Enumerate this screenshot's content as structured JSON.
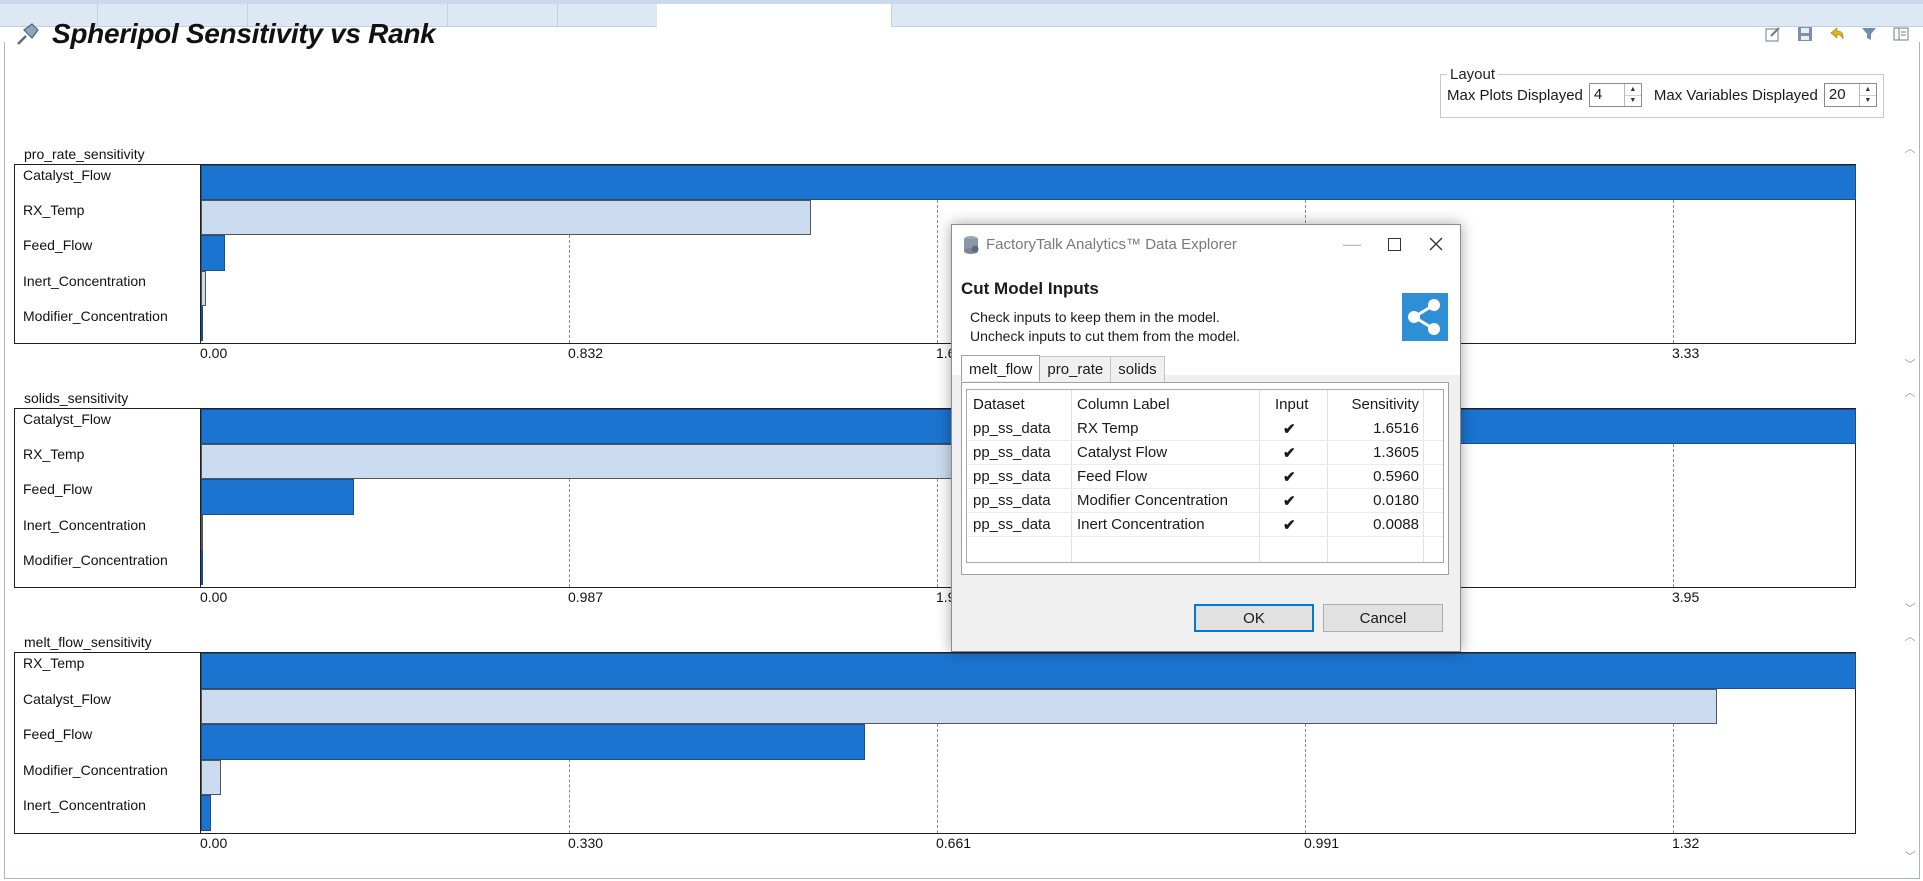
{
  "page": {
    "title": "Spheripol Sensitivity vs Rank"
  },
  "layout_box": {
    "legend": "Layout",
    "max_plots_label": "Max Plots Displayed",
    "max_plots_value": "4",
    "max_vars_label": "Max Variables Displayed",
    "max_vars_value": "20"
  },
  "charts": [
    {
      "name": "pro_rate_sensitivity",
      "rows": [
        {
          "label": "Catalyst_Flow",
          "value": 4.5,
          "style": "dark"
        },
        {
          "label": "RX_Temp",
          "value": 1.38,
          "style": "light"
        },
        {
          "label": "Feed_Flow",
          "value": 0.055,
          "style": "dark"
        },
        {
          "label": "Inert_Concentration",
          "value": 0.012,
          "style": "light"
        },
        {
          "label": "Modifier_Concentration",
          "value": 0.004,
          "style": "dark"
        }
      ],
      "ticks": [
        "0.00",
        "0.832",
        "1.6",
        "",
        "3.33"
      ],
      "tick_step": 0.832
    },
    {
      "name": "solids_sensitivity",
      "rows": [
        {
          "label": "Catalyst_Flow",
          "value": 4.5,
          "style": "dark"
        },
        {
          "label": "RX_Temp",
          "value": 2.1,
          "style": "light"
        },
        {
          "label": "Feed_Flow",
          "value": 0.41,
          "style": "dark"
        },
        {
          "label": "Inert_Concentration",
          "value": 0.006,
          "style": "light"
        },
        {
          "label": "Modifier_Concentration",
          "value": 0.003,
          "style": "dark"
        }
      ],
      "ticks": [
        "0.00",
        "0.987",
        "1.9",
        "",
        "3.95"
      ],
      "tick_step": 0.987
    },
    {
      "name": "melt_flow_sensitivity",
      "rows": [
        {
          "label": "RX_Temp",
          "value": 1.6516,
          "style": "dark"
        },
        {
          "label": "Catalyst_Flow",
          "value": 1.3605,
          "style": "light"
        },
        {
          "label": "Feed_Flow",
          "value": 0.596,
          "style": "dark"
        },
        {
          "label": "Modifier_Concentration",
          "value": 0.018,
          "style": "light"
        },
        {
          "label": "Inert_Concentration",
          "value": 0.0088,
          "style": "dark"
        }
      ],
      "ticks": [
        "0.00",
        "0.330",
        "0.661",
        "0.991",
        "1.32"
      ],
      "tick_step": 0.3303
    }
  ],
  "dialog": {
    "window_title": "FactoryTalk Analytics™ Data Explorer",
    "heading": "Cut Model Inputs",
    "desc1": "Check inputs to keep them in the model.",
    "desc2": "Uncheck inputs to cut them from the model.",
    "tabs": [
      "melt_flow",
      "pro_rate",
      "solids"
    ],
    "columns": [
      "Dataset",
      "Column Label",
      "Input",
      "Sensitivity"
    ],
    "rows": [
      {
        "dataset": "pp_ss_data",
        "label": "RX Temp",
        "input": "✔",
        "sensitivity": "1.6516"
      },
      {
        "dataset": "pp_ss_data",
        "label": "Catalyst Flow",
        "input": "✔",
        "sensitivity": "1.3605"
      },
      {
        "dataset": "pp_ss_data",
        "label": "Feed Flow",
        "input": "✔",
        "sensitivity": "0.5960"
      },
      {
        "dataset": "pp_ss_data",
        "label": "Modifier Concentration",
        "input": "✔",
        "sensitivity": "0.0180"
      },
      {
        "dataset": "pp_ss_data",
        "label": "Inert Concentration",
        "input": "✔",
        "sensitivity": "0.0088"
      }
    ],
    "ok_label": "OK",
    "cancel_label": "Cancel"
  },
  "colors": {
    "bar_dark": "#1b74d0",
    "bar_light": "#ccdcf0",
    "accent": "#0078d7"
  }
}
